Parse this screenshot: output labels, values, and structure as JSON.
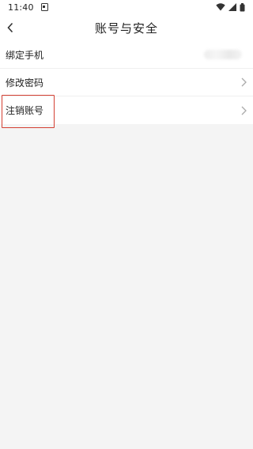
{
  "status_bar": {
    "time": "11:40"
  },
  "header": {
    "title": "账号与安全"
  },
  "list": {
    "items": [
      {
        "label": "绑定手机",
        "value_blurred": true
      },
      {
        "label": "修改密码"
      },
      {
        "label": "注销账号"
      }
    ]
  },
  "colors": {
    "highlight_border": "#d43f32",
    "background": "#f4f4f4",
    "row_background": "#ffffff"
  }
}
